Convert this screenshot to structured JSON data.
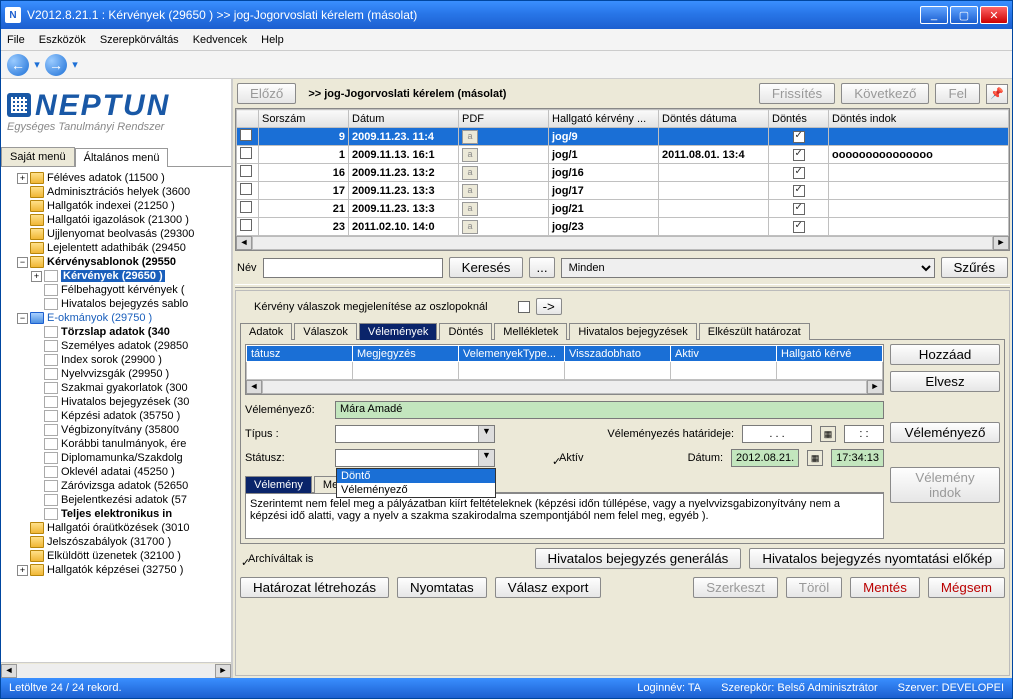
{
  "window": {
    "title": "V2012.8.21.1 : Kérvények (29650 )  >> jog-Jogorvoslati kérelem (másolat)",
    "min": "_",
    "max": "▢",
    "close": "✕",
    "appiconletter": "N"
  },
  "menubar": [
    "File",
    "Eszközök",
    "Szerepkörváltás",
    "Kedvencek",
    "Help"
  ],
  "logo": {
    "brand": "NEPTUN",
    "sub": "Egységes Tanulmányi Rendszer"
  },
  "lefttabs": {
    "a": "Saját menü",
    "b": "Általános menü"
  },
  "tree": [
    {
      "d": 1,
      "exp": "+",
      "ic": "folder",
      "lbl": "Féléves adatok (11500 )"
    },
    {
      "d": 1,
      "exp": "",
      "ic": "folder",
      "lbl": "Adminisztrációs helyek (3600"
    },
    {
      "d": 1,
      "exp": "",
      "ic": "folder",
      "lbl": "Hallgatók indexei (21250 )"
    },
    {
      "d": 1,
      "exp": "",
      "ic": "folder",
      "lbl": "Hallgatói igazolások (21300 )"
    },
    {
      "d": 1,
      "exp": "",
      "ic": "folder",
      "lbl": "Ujjlenyomat beolvasás (29300"
    },
    {
      "d": 1,
      "exp": "",
      "ic": "folder",
      "lbl": "Lejelentett adathibák (29450"
    },
    {
      "d": 1,
      "exp": "−",
      "ic": "folder",
      "lbl": "Kérvénysablonok (29550",
      "bold": true
    },
    {
      "d": 2,
      "exp": "+",
      "ic": "page",
      "lbl": "Kérvények (29650 )",
      "sel": true,
      "bold": true
    },
    {
      "d": 2,
      "exp": "",
      "ic": "page",
      "lbl": "Félbehagyott kérvények ("
    },
    {
      "d": 2,
      "exp": "",
      "ic": "page",
      "lbl": "Hivatalos bejegyzés sablo"
    },
    {
      "d": 1,
      "exp": "−",
      "ic": "folderblue",
      "lbl": "E-okmányok (29750 )",
      "blue": true
    },
    {
      "d": 2,
      "exp": "",
      "ic": "page",
      "lbl": "Törzslap adatok (340",
      "bold": true
    },
    {
      "d": 2,
      "exp": "",
      "ic": "page",
      "lbl": "Személyes adatok (29850"
    },
    {
      "d": 2,
      "exp": "",
      "ic": "page",
      "lbl": "Index sorok (29900 )"
    },
    {
      "d": 2,
      "exp": "",
      "ic": "page",
      "lbl": "Nyelvvizsgák (29950 )"
    },
    {
      "d": 2,
      "exp": "",
      "ic": "page",
      "lbl": "Szakmai gyakorlatok (300"
    },
    {
      "d": 2,
      "exp": "",
      "ic": "page",
      "lbl": "Hivatalos bejegyzések (30"
    },
    {
      "d": 2,
      "exp": "",
      "ic": "page",
      "lbl": "Képzési adatok (35750 )"
    },
    {
      "d": 2,
      "exp": "",
      "ic": "page",
      "lbl": "Végbizonyítvány (35800"
    },
    {
      "d": 2,
      "exp": "",
      "ic": "page",
      "lbl": "Korábbi tanulmányok, ére"
    },
    {
      "d": 2,
      "exp": "",
      "ic": "page",
      "lbl": "Diplomamunka/Szakdolg"
    },
    {
      "d": 2,
      "exp": "",
      "ic": "page",
      "lbl": "Oklevél adatai (45250 )"
    },
    {
      "d": 2,
      "exp": "",
      "ic": "page",
      "lbl": "Záróvizsga adatok (52650"
    },
    {
      "d": 2,
      "exp": "",
      "ic": "page",
      "lbl": "Bejelentkezési adatok (57"
    },
    {
      "d": 2,
      "exp": "",
      "ic": "page",
      "lbl": "Teljes elektronikus in",
      "bold": true
    },
    {
      "d": 1,
      "exp": "",
      "ic": "folder",
      "lbl": "Hallgatói óraütközések (3010"
    },
    {
      "d": 1,
      "exp": "",
      "ic": "folder",
      "lbl": "Jelszószabályok (31700 )"
    },
    {
      "d": 1,
      "exp": "",
      "ic": "folder",
      "lbl": "Elküldött üzenetek (32100 )"
    },
    {
      "d": 1,
      "exp": "+",
      "ic": "folder",
      "lbl": "Hallgatók képzései (32750 )"
    }
  ],
  "topbar": {
    "prev": "Előző",
    "crumb": ">> jog-Jogorvoslati kérelem (másolat)",
    "refresh": "Frissítés",
    "next": "Következő",
    "up": "Fel"
  },
  "gridcols": [
    "",
    "Sorszám",
    "Dátum",
    "PDF",
    "Hallgató kérvény ...",
    "Döntés dátuma",
    "Döntés",
    "Döntés indok"
  ],
  "gridrows": [
    {
      "sel": true,
      "sor": "9",
      "dat": "2009.11.23. 11:4",
      "kv": "jog/9",
      "dd": "",
      "dchk": true,
      "ind": ""
    },
    {
      "sel": false,
      "sor": "1",
      "dat": "2009.11.13. 16:1",
      "kv": "jog/1",
      "dd": "2011.08.01. 13:4",
      "dchk": true,
      "ind": "ooooooooooooooo"
    },
    {
      "sel": false,
      "sor": "16",
      "dat": "2009.11.23. 13:2",
      "kv": "jog/16",
      "dd": "",
      "dchk": true,
      "ind": ""
    },
    {
      "sel": false,
      "sor": "17",
      "dat": "2009.11.23. 13:3",
      "kv": "jog/17",
      "dd": "",
      "dchk": true,
      "ind": ""
    },
    {
      "sel": false,
      "sor": "21",
      "dat": "2009.11.23. 13:3",
      "kv": "jog/21",
      "dd": "",
      "dchk": true,
      "ind": ""
    },
    {
      "sel": false,
      "sor": "23",
      "dat": "2011.02.10. 14:0",
      "kv": "jog/23",
      "dd": "",
      "dchk": true,
      "ind": ""
    }
  ],
  "search": {
    "nev": "Név",
    "keres": "Keresés",
    "dots": "...",
    "minden": "Minden",
    "szures": "Szűrés"
  },
  "colopts": {
    "lbl": "Kérvény válaszok megjelenítése az oszlopoknál",
    "arrow": "->"
  },
  "tabs": [
    "Adatok",
    "Válaszok",
    "Vélemények",
    "Döntés",
    "Mellékletek",
    "Hivatalos bejegyzések",
    "Elkészült határozat"
  ],
  "innerhead": [
    "tátusz",
    "Megjegyzés",
    "VelemenyekType...",
    "Visszadobhato",
    "Aktiv",
    "Hallgató kérvé"
  ],
  "rside": {
    "add": "Hozzáad",
    "rem": "Elvesz",
    "op": "Véleményező",
    "opind": "Vélemény indok"
  },
  "form": {
    "velemenyezo_lbl": "Véleményező:",
    "velemenyezo_val": "Mára Amadé",
    "tipus_lbl": "Típus :",
    "statusz_lbl": "Státusz:",
    "droplist": [
      "Döntő",
      "Véleményező"
    ],
    "hatarido_lbl": "Véleményezés határideje:",
    "hatarido_date": ". . .",
    "hatarido_time": ": :",
    "datum_lbl": "Dátum:",
    "datum_date": "2012.08.21.",
    "datum_time": "17:34:13",
    "aktiv": "Aktív"
  },
  "optabs": [
    "Vélemény",
    "Megjegyzés"
  ],
  "opinion_text": "Szerintemt nem felel meg a pályázatban kiírt feltételeknek (képzési időn túllépése, vagy a nyelvvizsgabizonyítvány nem a képzési idő alatti, vagy a nyelv a szakma szakirodalma szempontjából nem felel meg, egyéb ).",
  "bottom": {
    "arch": "Archíváltak is",
    "hbgen": "Hivatalos bejegyzés generálás",
    "hbprint": "Hivatalos bejegyzés nyomtatási előkép",
    "hat": "Határozat létrehozás",
    "nyom": "Nyomtatas",
    "val": "Válasz export",
    "szerk": "Szerkeszt",
    "torol": "Töröl",
    "ment": "Mentés",
    "megsem": "Mégsem"
  },
  "status": {
    "rec": "Letöltve 24 / 24 rekord.",
    "login": "Loginnév: TA",
    "role": "Szerepkör: Belső Adminisztrátor",
    "srv": "Szerver: DEVELOPEI"
  }
}
